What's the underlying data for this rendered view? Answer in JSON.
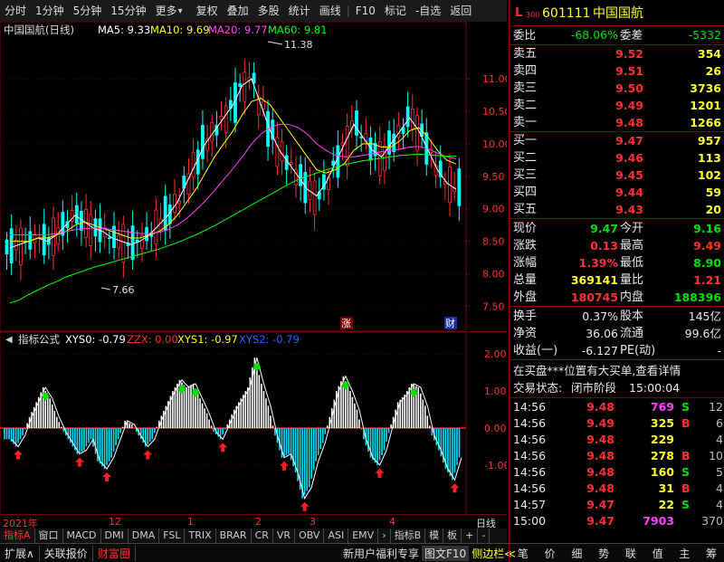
{
  "topbar": {
    "items": [
      "分时",
      "1分钟",
      "5分钟",
      "15分钟",
      "更多",
      "复权",
      "叠加",
      "多股",
      "统计",
      "画线",
      "F10",
      "标记",
      "-自选",
      "返回"
    ]
  },
  "main_chart": {
    "title": "中国国航(日线)",
    "ma5": "MA5: 9.33",
    "ma10": "MA10: 9.69",
    "ma20": "MA20: 9.77",
    "ma60": "MA60: 9.81",
    "high_label": "11.38",
    "low_label": "7.66",
    "badge_zhang": "涨",
    "badge_cai": "财",
    "colors": {
      "ma5": "#ffffff",
      "ma10": "#ffff00",
      "ma20": "#ff40ff",
      "ma60": "#00ff00",
      "up": "#ff3030",
      "down": "#00ffff"
    }
  },
  "indicator": {
    "title": "指标公式",
    "xys0": "XYS0: -0.79",
    "zzx": "ZZX: 0.00",
    "xys1": "XYS1: -0.97",
    "xys2": "XYS2: -0.79"
  },
  "timeline": {
    "labels": [
      "2021年",
      "12",
      "1",
      "2",
      "3",
      "4"
    ],
    "right_label": "日线"
  },
  "chart_data": [
    {
      "type": "candlestick",
      "title": "中国国航(日线)",
      "ylim": [
        7.2,
        11.6
      ],
      "y_ticks": [
        "11.00",
        "10.50",
        "10.00",
        "9.50",
        "9.00",
        "8.50",
        "8.00",
        "7.50"
      ],
      "y_tick_values": [
        11.0,
        10.5,
        10.0,
        9.5,
        9.0,
        8.5,
        8.0,
        7.5
      ],
      "series": [
        {
          "name": "MA5",
          "values": [
            8.4,
            8.45,
            8.5,
            8.55,
            8.5,
            8.6,
            8.75,
            8.9,
            8.8,
            8.7,
            8.65,
            8.55,
            8.5,
            8.45,
            8.5,
            8.6,
            8.75,
            8.9,
            9.1,
            9.4,
            9.7,
            10.0,
            10.2,
            10.4,
            10.6,
            10.9,
            11.0,
            10.6,
            10.2,
            9.9,
            9.7,
            9.5,
            9.3,
            9.2,
            9.4,
            9.7,
            10.0,
            10.3,
            10.1,
            9.9,
            9.8,
            10.0,
            10.2,
            10.4,
            10.2,
            9.9,
            9.6,
            9.4,
            9.3
          ]
        },
        {
          "name": "MA10",
          "values": [
            8.5,
            8.5,
            8.5,
            8.55,
            8.55,
            8.6,
            8.65,
            8.75,
            8.8,
            8.75,
            8.7,
            8.65,
            8.6,
            8.55,
            8.55,
            8.6,
            8.65,
            8.75,
            8.9,
            9.1,
            9.3,
            9.55,
            9.8,
            10.0,
            10.2,
            10.45,
            10.65,
            10.7,
            10.6,
            10.4,
            10.2,
            10.0,
            9.8,
            9.6,
            9.55,
            9.6,
            9.7,
            9.9,
            10.0,
            10.0,
            9.95,
            9.95,
            10.05,
            10.2,
            10.25,
            10.1,
            9.9,
            9.75,
            9.69
          ]
        },
        {
          "name": "MA20",
          "values": [
            8.6,
            8.6,
            8.6,
            8.6,
            8.6,
            8.62,
            8.65,
            8.68,
            8.7,
            8.7,
            8.7,
            8.68,
            8.66,
            8.64,
            8.62,
            8.62,
            8.64,
            8.68,
            8.75,
            8.85,
            8.98,
            9.12,
            9.28,
            9.45,
            9.62,
            9.8,
            10.0,
            10.15,
            10.25,
            10.3,
            10.3,
            10.25,
            10.15,
            10.0,
            9.9,
            9.82,
            9.8,
            9.8,
            9.82,
            9.85,
            9.88,
            9.9,
            9.92,
            9.95,
            9.96,
            9.92,
            9.86,
            9.8,
            9.77
          ]
        },
        {
          "name": "MA60",
          "values": [
            7.55,
            7.6,
            7.68,
            7.75,
            7.82,
            7.88,
            7.95,
            8.0,
            8.05,
            8.1,
            8.14,
            8.18,
            8.22,
            8.26,
            8.3,
            8.34,
            8.38,
            8.43,
            8.48,
            8.54,
            8.6,
            8.67,
            8.74,
            8.82,
            8.9,
            8.98,
            9.06,
            9.14,
            9.22,
            9.3,
            9.38,
            9.45,
            9.5,
            9.55,
            9.6,
            9.64,
            9.68,
            9.71,
            9.74,
            9.76,
            9.78,
            9.8,
            9.82,
            9.83,
            9.84,
            9.83,
            9.82,
            9.81,
            9.81
          ]
        }
      ]
    },
    {
      "type": "bar",
      "title": "指标公式",
      "ylim": [
        -2.2,
        2.2
      ],
      "y_ticks": [
        "2.00",
        "1.00",
        "0.00",
        "-1.00"
      ],
      "y_tick_values": [
        2.0,
        1.0,
        0.0,
        -1.0
      ],
      "values": [
        -0.3,
        -0.5,
        -0.2,
        0.3,
        0.7,
        1.1,
        0.8,
        0.3,
        -0.1,
        -0.4,
        -0.7,
        -0.6,
        -0.3,
        -0.9,
        -1.1,
        -0.8,
        -0.3,
        0.2,
        0.1,
        -0.2,
        -0.5,
        -0.3,
        0.2,
        0.6,
        1.0,
        1.3,
        1.1,
        1.2,
        0.8,
        0.4,
        -0.1,
        -0.3,
        0.1,
        0.5,
        0.8,
        1.1,
        1.9,
        1.2,
        0.6,
        -0.2,
        -0.8,
        -0.7,
        -1.2,
        -1.9,
        -1.6,
        -0.9,
        -0.4,
        0.3,
        1.0,
        1.4,
        1.0,
        0.5,
        -0.3,
        -0.8,
        -1.0,
        -0.6,
        0.1,
        0.7,
        0.9,
        1.2,
        1.1,
        0.6,
        -0.2,
        -0.6,
        -1.1,
        -1.4,
        -0.8
      ]
    }
  ],
  "stock": {
    "code": "601111",
    "name": "中国国航",
    "badge_top": "L",
    "badge_num": "300",
    "weibi_label": "委比",
    "weibi": "-68.06%",
    "weicha_label": "委差",
    "weicha": "-5332"
  },
  "orderbook": {
    "asks": [
      {
        "label": "卖五",
        "price": "9.52",
        "vol": "354"
      },
      {
        "label": "卖四",
        "price": "9.51",
        "vol": "26"
      },
      {
        "label": "卖三",
        "price": "9.50",
        "vol": "3736"
      },
      {
        "label": "卖二",
        "price": "9.49",
        "vol": "1201"
      },
      {
        "label": "卖一",
        "price": "9.48",
        "vol": "1266"
      }
    ],
    "bids": [
      {
        "label": "买一",
        "price": "9.47",
        "vol": "957"
      },
      {
        "label": "买二",
        "price": "9.46",
        "vol": "113"
      },
      {
        "label": "买三",
        "price": "9.45",
        "vol": "102"
      },
      {
        "label": "买四",
        "price": "9.44",
        "vol": "59"
      },
      {
        "label": "买五",
        "price": "9.43",
        "vol": "20"
      }
    ]
  },
  "quote": {
    "rows": [
      {
        "l1": "现价",
        "v1": "9.47",
        "c1": "green",
        "l2": "今开",
        "v2": "9.16",
        "c2": "green"
      },
      {
        "l1": "涨跌",
        "v1": "0.13",
        "c1": "red",
        "l2": "最高",
        "v2": "9.49",
        "c2": "red"
      },
      {
        "l1": "涨幅",
        "v1": "1.39%",
        "c1": "red",
        "l2": "最低",
        "v2": "8.90",
        "c2": "green"
      },
      {
        "l1": "总量",
        "v1": "369141",
        "c1": "yellow",
        "l2": "量比",
        "v2": "1.21",
        "c2": "red"
      },
      {
        "l1": "外盘",
        "v1": "180745",
        "c1": "red",
        "l2": "内盘",
        "v2": "188396",
        "c2": "green"
      }
    ],
    "rows2": [
      {
        "l1": "换手",
        "v1": "0.37%",
        "l2": "股本",
        "v2": "145亿"
      },
      {
        "l1": "净资",
        "v1": "36.06",
        "l2": "流通",
        "v2": "99.6亿"
      },
      {
        "l1": "收益(一)",
        "v1": "-6.127",
        "l2": "PE(动)",
        "v2": "-"
      }
    ]
  },
  "notice": {
    "line1": "在买盘***位置有大买单,查看详情",
    "status_label": "交易状态:",
    "status_value": "闭市阶段",
    "status_time": "15:00:04"
  },
  "ticks": [
    {
      "t": "14:56",
      "p": "9.48",
      "v": "769",
      "vc": "magenta",
      "d": "S",
      "dc": "green",
      "n": "12"
    },
    {
      "t": "14:56",
      "p": "9.49",
      "v": "325",
      "vc": "yellow",
      "d": "B",
      "dc": "red",
      "n": "6"
    },
    {
      "t": "14:56",
      "p": "9.48",
      "v": "229",
      "vc": "yellow",
      "d": "",
      "dc": "",
      "n": "4"
    },
    {
      "t": "14:56",
      "p": "9.48",
      "v": "278",
      "vc": "yellow",
      "d": "B",
      "dc": "red",
      "n": "10"
    },
    {
      "t": "14:56",
      "p": "9.48",
      "v": "160",
      "vc": "yellow",
      "d": "S",
      "dc": "green",
      "n": "5"
    },
    {
      "t": "14:56",
      "p": "9.48",
      "v": "31",
      "vc": "yellow",
      "d": "B",
      "dc": "red",
      "n": "4"
    },
    {
      "t": "14:57",
      "p": "9.47",
      "v": "22",
      "vc": "yellow",
      "d": "S",
      "dc": "green",
      "n": "4"
    },
    {
      "t": "15:00",
      "p": "9.47",
      "v": "7903",
      "vc": "magenta",
      "d": "",
      "dc": "",
      "n": "370"
    }
  ],
  "bottom_tabs": [
    "指标A",
    "窗口",
    "MACD",
    "DMI",
    "DMA",
    "FSL",
    "TRIX",
    "BRAR",
    "CR",
    "VR",
    "OBV",
    "ASI",
    "EMV",
    "›",
    "指标B",
    "模",
    "板",
    "+",
    "-"
  ],
  "status_bar": {
    "left": [
      "扩展∧",
      "关联报价",
      "财富圈"
    ],
    "middle": [
      "新用户福利专享",
      "图文F10",
      "侧边栏≪"
    ],
    "right": [
      "笔",
      "价",
      "细",
      "势",
      "联",
      "值",
      "主",
      "筹"
    ]
  }
}
